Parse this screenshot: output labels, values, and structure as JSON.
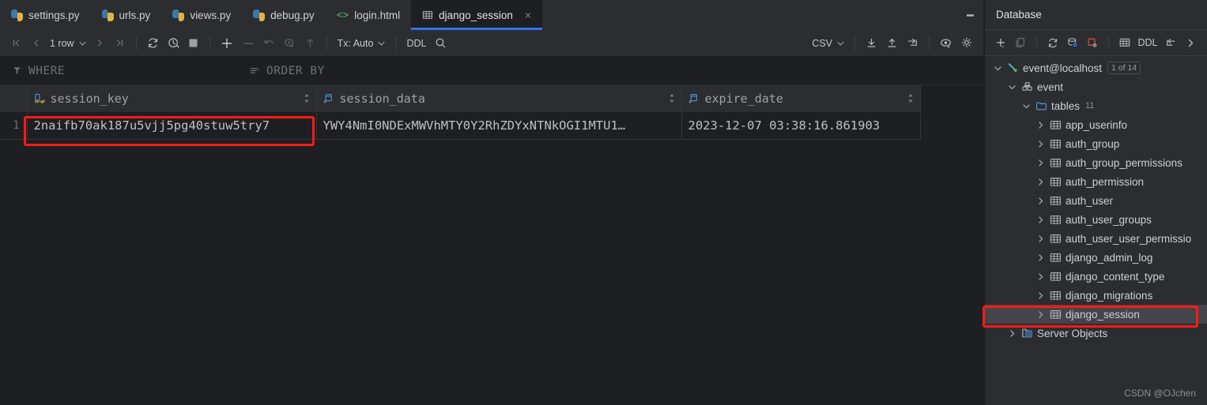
{
  "editor": {
    "tabs": [
      {
        "label": "settings.py",
        "icon": "python-icon",
        "active": false,
        "closable": false
      },
      {
        "label": "urls.py",
        "icon": "python-icon",
        "active": false,
        "closable": false
      },
      {
        "label": "views.py",
        "icon": "python-icon",
        "active": false,
        "closable": false
      },
      {
        "label": "debug.py",
        "icon": "python-icon",
        "active": false,
        "closable": false
      },
      {
        "label": "login.html",
        "icon": "html-icon",
        "active": false,
        "closable": false
      },
      {
        "label": "django_session",
        "icon": "table-icon",
        "active": true,
        "closable": true
      }
    ],
    "tab_close_glyph": "×",
    "overflow_menu": "more-options"
  },
  "toolbar": {
    "first_page": "❘◀",
    "prev_page": "◀",
    "row_count_label": "1 row",
    "next_page": "▶",
    "last_page": "▶❘",
    "refresh": "refresh-icon",
    "history": "history-icon",
    "stop": "stop-icon",
    "add_row": "+",
    "delete_row": "−",
    "revert": "revert-icon",
    "submit": "submit-icon",
    "upload": "upload-icon",
    "tx_label": "Tx: Auto",
    "ddl_label": "DDL",
    "search": "search-icon",
    "csv_label": "CSV",
    "export_to_file": "download-icon",
    "import_from_file": "import-icon",
    "jump_to": "jump-icon",
    "view_options": "eye-icon",
    "settings": "gear-icon"
  },
  "filterbar": {
    "where_label": "WHERE",
    "where_icon": "filter-icon",
    "order_label": "ORDER BY",
    "order_icon": "sort-icon"
  },
  "grid": {
    "columns": [
      {
        "name": "session_key",
        "icon": "primary-key-icon"
      },
      {
        "name": "session_data",
        "icon": "column-icon"
      },
      {
        "name": "expire_date",
        "icon": "column-icon"
      }
    ],
    "rows": [
      {
        "number": "1",
        "session_key": "2naifb70ak187u5vjj5pg40stuw5try7",
        "session_data": "YWY4NmI0NDExMWVhMTY0Y2RhZDYxNTNkOGI1MTU1…",
        "expire_date": "2023-12-07 03:38:16.861903"
      }
    ]
  },
  "database_panel": {
    "title": "Database",
    "toolbar": {
      "new": "plus-icon",
      "duplicate": "copy-icon",
      "refresh": "refresh-icon",
      "data_source_properties": "database-icon",
      "modify": "modify-icon",
      "jump_to_query_console": "table-icon",
      "ddl_label": "DDL",
      "jump_to": "jump-icon",
      "expand": "chevron-right-icon"
    },
    "tree": [
      {
        "label": "event@localhost",
        "icon": "connection-icon",
        "indent": 0,
        "expanded": true,
        "badge": "1 of 14",
        "count": "",
        "selected": false
      },
      {
        "label": "event",
        "icon": "schema-icon",
        "indent": 1,
        "expanded": true,
        "badge": "",
        "count": "",
        "selected": false
      },
      {
        "label": "tables",
        "icon": "folder-icon",
        "indent": 2,
        "expanded": true,
        "badge": "",
        "count": "11",
        "selected": false
      },
      {
        "label": "app_userinfo",
        "icon": "table-icon",
        "indent": 3,
        "expanded": false,
        "badge": "",
        "count": "",
        "selected": false
      },
      {
        "label": "auth_group",
        "icon": "table-icon",
        "indent": 3,
        "expanded": false,
        "badge": "",
        "count": "",
        "selected": false
      },
      {
        "label": "auth_group_permissions",
        "icon": "table-icon",
        "indent": 3,
        "expanded": false,
        "badge": "",
        "count": "",
        "selected": false
      },
      {
        "label": "auth_permission",
        "icon": "table-icon",
        "indent": 3,
        "expanded": false,
        "badge": "",
        "count": "",
        "selected": false
      },
      {
        "label": "auth_user",
        "icon": "table-icon",
        "indent": 3,
        "expanded": false,
        "badge": "",
        "count": "",
        "selected": false
      },
      {
        "label": "auth_user_groups",
        "icon": "table-icon",
        "indent": 3,
        "expanded": false,
        "badge": "",
        "count": "",
        "selected": false
      },
      {
        "label": "auth_user_user_permissio",
        "icon": "table-icon",
        "indent": 3,
        "expanded": false,
        "badge": "",
        "count": "",
        "selected": false
      },
      {
        "label": "django_admin_log",
        "icon": "table-icon",
        "indent": 3,
        "expanded": false,
        "badge": "",
        "count": "",
        "selected": false
      },
      {
        "label": "django_content_type",
        "icon": "table-icon",
        "indent": 3,
        "expanded": false,
        "badge": "",
        "count": "",
        "selected": false
      },
      {
        "label": "django_migrations",
        "icon": "table-icon",
        "indent": 3,
        "expanded": false,
        "badge": "",
        "count": "",
        "selected": false
      },
      {
        "label": "django_session",
        "icon": "table-icon",
        "indent": 3,
        "expanded": false,
        "badge": "",
        "count": "",
        "selected": true
      },
      {
        "label": "Server Objects",
        "icon": "server-objects-icon",
        "indent": 1,
        "expanded": false,
        "badge": "",
        "count": "",
        "selected": false
      }
    ]
  },
  "watermark": "CSDN @OJchen",
  "annotations": {
    "highlight_color": "#ff1a17",
    "boxes": [
      {
        "target": "session-key-cell"
      },
      {
        "target": "tree-item-django-session"
      }
    ]
  }
}
